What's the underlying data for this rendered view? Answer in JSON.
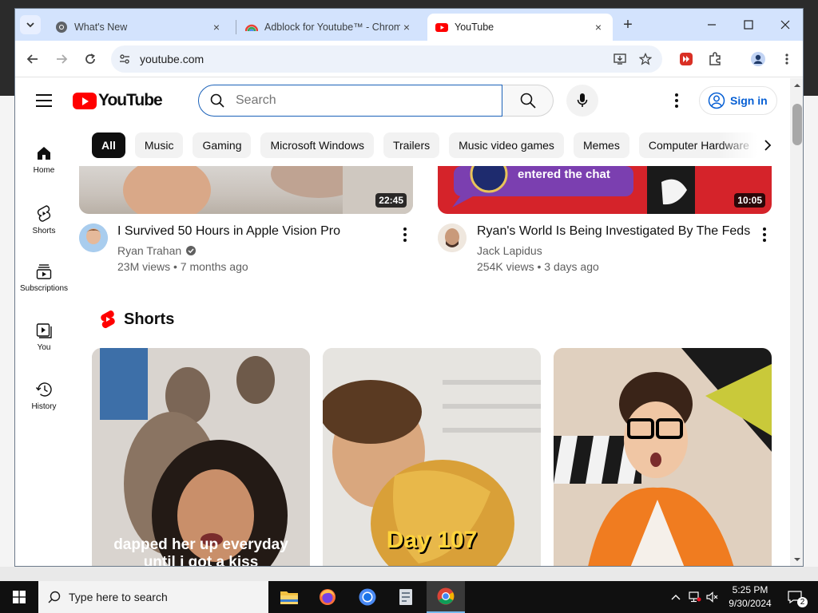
{
  "browser": {
    "tabs": [
      {
        "title": "What's New",
        "close": "×"
      },
      {
        "title": "Adblock for Youtube™ - Chrome",
        "close": "×"
      },
      {
        "title": "YouTube",
        "close": "×"
      }
    ],
    "new_tab": "+",
    "url": "youtube.com"
  },
  "youtube": {
    "logo_text": "YouTube",
    "search_placeholder": "Search",
    "sign_in": "Sign in",
    "sidebar": [
      {
        "label": "Home",
        "icon": "home-icon"
      },
      {
        "label": "Shorts",
        "icon": "shorts-icon"
      },
      {
        "label": "Subscriptions",
        "icon": "subscriptions-icon"
      },
      {
        "label": "You",
        "icon": "you-icon"
      },
      {
        "label": "History",
        "icon": "history-icon"
      }
    ],
    "chips": [
      "All",
      "Music",
      "Gaming",
      "Microsoft Windows",
      "Trailers",
      "Music video games",
      "Memes",
      "Computer Hardware"
    ],
    "videos": [
      {
        "title": "I Survived 50 Hours in Apple Vision Pro",
        "channel": "Ryan Trahan",
        "verified": true,
        "meta": "23M views • 7 months ago",
        "duration": "22:45"
      },
      {
        "title": "Ryan's World Is Being Investigated By The Feds",
        "channel": "Jack Lapidus",
        "verified": false,
        "meta": "254K views • 3 days ago",
        "duration": "10:05",
        "thumb_text": "entered the chat"
      }
    ],
    "shorts_title": "Shorts",
    "shorts": [
      {
        "caption": "dapped her up everyday",
        "caption2": "until i got a kiss"
      },
      {
        "caption": "Day 107"
      },
      {
        "caption": ""
      }
    ]
  },
  "taskbar": {
    "search_placeholder": "Type here to search",
    "time": "5:25 PM",
    "date": "9/30/2024",
    "notifications": "2"
  },
  "colors": {
    "brand_red": "#ff0000",
    "link_blue": "#065fd4",
    "tab_strip": "#d3e3fd"
  }
}
